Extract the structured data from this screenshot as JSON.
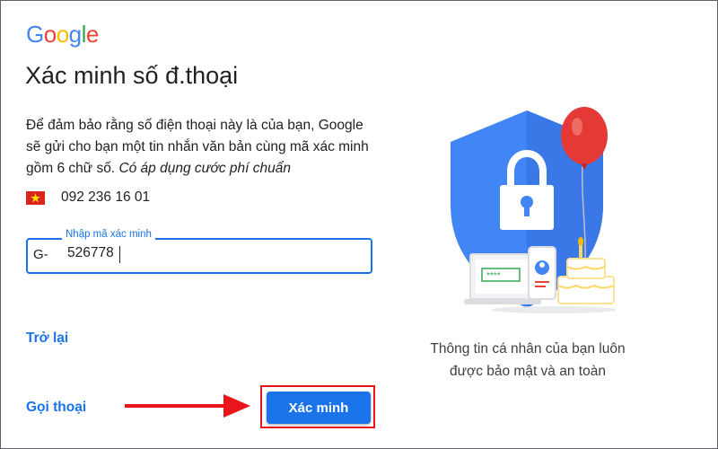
{
  "logo": {
    "text": "Google",
    "letters": [
      "G",
      "o",
      "o",
      "g",
      "l",
      "e"
    ],
    "colors": [
      "#4285F4",
      "#EA4335",
      "#FBBC05",
      "#4285F4",
      "#34A853",
      "#EA4335"
    ]
  },
  "page": {
    "title": "Xác minh số đ.thoại",
    "description_main": "Để đảm bảo rằng số điện thoại này là của bạn, Google sẽ gửi cho bạn một tin nhắn văn bản cùng mã xác minh gồm 6 chữ số.",
    "description_italic": "Có áp dụng cước phí chuẩn"
  },
  "phone": {
    "flag_icon": "vietnam-flag-icon",
    "number": "092 236 16 01"
  },
  "code_field": {
    "label": "Nhập mã xác minh",
    "prefix": "G-",
    "value": "526778"
  },
  "links": {
    "back": "Trở lại",
    "call": "Gọi thoại"
  },
  "verify_button": {
    "label": "Xác minh",
    "color": "#1a73e8"
  },
  "caption": {
    "line1": "Thông tin cá nhân của bạn luôn",
    "line2": "được bảo mật và an toàn"
  },
  "colors": {
    "accent": "#1a73e8",
    "annotation_red": "#e8151b"
  }
}
